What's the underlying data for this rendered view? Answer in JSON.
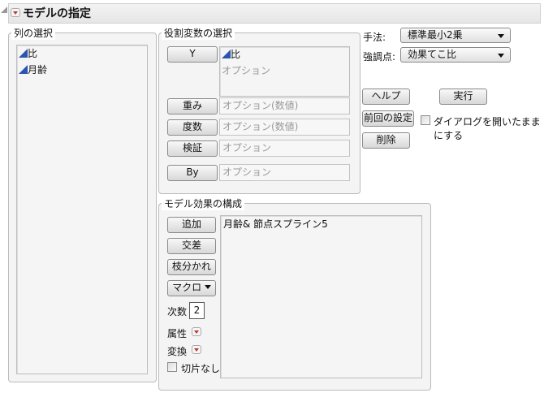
{
  "header": {
    "title": "モデルの指定"
  },
  "columns": {
    "label": "列の選択",
    "items": [
      "比",
      "月齢"
    ]
  },
  "roles": {
    "label": "役割変数の選択",
    "y_button": "Y",
    "y_value": "比",
    "y_placeholder": "オプション",
    "rows": [
      {
        "button": "重み",
        "placeholder": "オプション(数値)"
      },
      {
        "button": "度数",
        "placeholder": "オプション(数値)"
      },
      {
        "button": "検証",
        "placeholder": "オプション"
      },
      {
        "button": "By",
        "placeholder": "オプション"
      }
    ]
  },
  "options": {
    "method_label": "手法:",
    "method_value": "標準最小2乗",
    "emphasis_label": "強調点:",
    "emphasis_value": "効果てこ比"
  },
  "actions": {
    "help": "ヘルプ",
    "run": "実行",
    "recall": "前回の設定",
    "keep_open": "ダイアログを開いたままにする",
    "remove": "削除"
  },
  "effects": {
    "label": "モデル効果の構成",
    "add": "追加",
    "cross": "交差",
    "nest": "枝分かれ",
    "macros": "マクロ",
    "degree_label": "次数",
    "degree_value": "2",
    "attributes": "属性",
    "transform": "変換",
    "no_intercept": "切片なし",
    "items": [
      "月齢& 節点スプライン5"
    ]
  }
}
